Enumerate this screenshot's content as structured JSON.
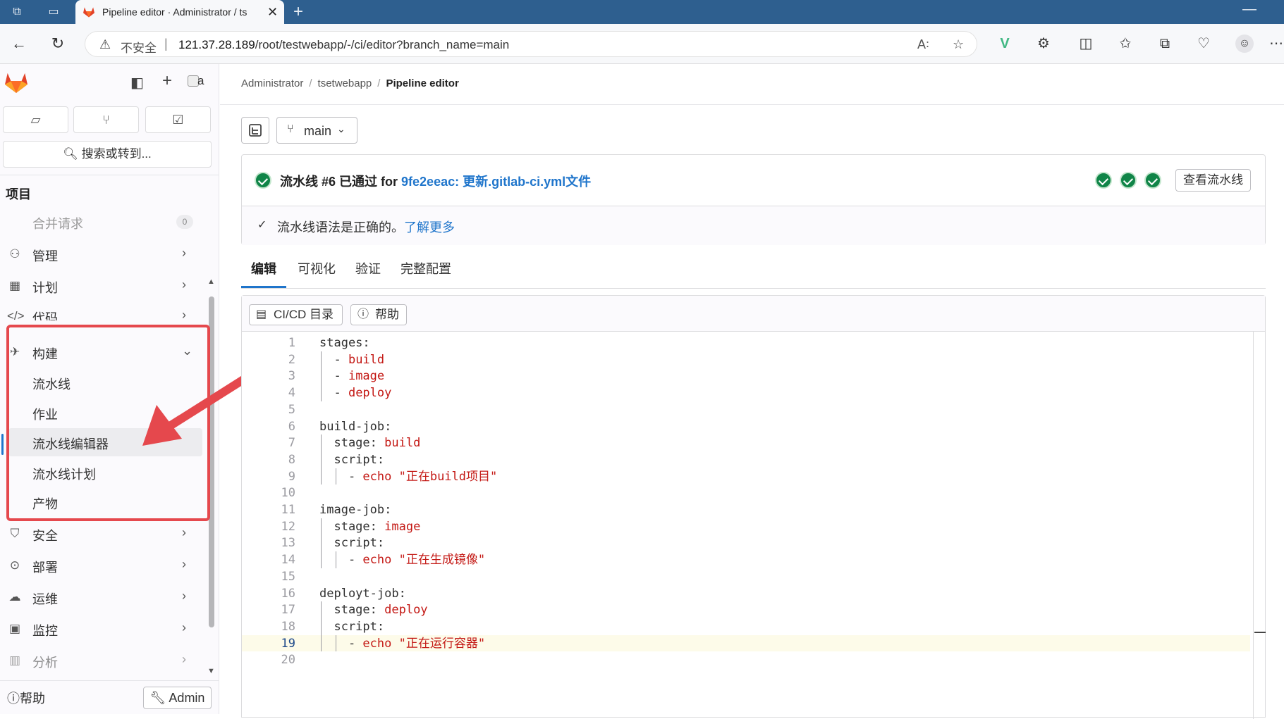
{
  "browser": {
    "tab_title": "Pipeline editor · Administrator / ts",
    "insecure_label": "不安全",
    "url_host": "121.37.28.189",
    "url_path": "/root/testwebapp/-/ci/editor?branch_name=main"
  },
  "sidebar": {
    "search_label": "搜索或转到...",
    "section_title": "项目",
    "merge_requests": {
      "label": "合并请求",
      "count": "0"
    },
    "items": [
      {
        "label": "管理",
        "icon": "users-icon"
      },
      {
        "label": "计划",
        "icon": "calendar-icon"
      },
      {
        "label": "代码",
        "icon": "code-icon"
      },
      {
        "label": "构建",
        "icon": "rocket-icon"
      }
    ],
    "build_sub": [
      {
        "label": "流水线"
      },
      {
        "label": "作业"
      },
      {
        "label": "流水线编辑器",
        "active": true
      },
      {
        "label": "流水线计划"
      },
      {
        "label": "产物"
      }
    ],
    "items_after": [
      {
        "label": "安全",
        "icon": "shield-icon"
      },
      {
        "label": "部署",
        "icon": "deploy-icon"
      },
      {
        "label": "运维",
        "icon": "cloud-icon"
      },
      {
        "label": "监控",
        "icon": "monitor-icon"
      },
      {
        "label": "分析",
        "icon": "chart-icon"
      }
    ],
    "help_label": "帮助",
    "admin_label": "Admin"
  },
  "breadcrumb": {
    "root": "Administrator",
    "project": "tsetwebapp",
    "current": "Pipeline editor"
  },
  "branch": "main",
  "status": {
    "prefix": "流水线 #6 已通过 for ",
    "commit_link": "9fe2eeac: 更新.gitlab-ci.yml文件",
    "view_button": "查看流水线",
    "lint_text": "流水线语法是正确的。",
    "lint_link": "了解更多"
  },
  "tabs": [
    "编辑",
    "可视化",
    "验证",
    "完整配置"
  ],
  "toolbar": {
    "catalog_label": "CI/CD 目录",
    "help_label": "帮助"
  },
  "code_lines": [
    {
      "k": "stages:",
      "v": ""
    },
    {
      "k": "  - ",
      "v": "build"
    },
    {
      "k": "  - ",
      "v": "image"
    },
    {
      "k": "  - ",
      "v": "deploy"
    },
    {
      "k": "",
      "v": ""
    },
    {
      "k": "build-job:",
      "v": ""
    },
    {
      "k": "  stage: ",
      "v": "build"
    },
    {
      "k": "  script:",
      "v": ""
    },
    {
      "k": "    - ",
      "v": "echo \"正在build项目\""
    },
    {
      "k": "",
      "v": ""
    },
    {
      "k": "image-job:",
      "v": ""
    },
    {
      "k": "  stage: ",
      "v": "image"
    },
    {
      "k": "  script:",
      "v": ""
    },
    {
      "k": "    - ",
      "v": "echo \"正在生成镜像\""
    },
    {
      "k": "",
      "v": ""
    },
    {
      "k": "deployt-job:",
      "v": ""
    },
    {
      "k": "  stage: ",
      "v": "deploy"
    },
    {
      "k": "  script:",
      "v": ""
    },
    {
      "k": "    - ",
      "v": "echo \"正在运行容器\""
    },
    {
      "k": "",
      "v": ""
    }
  ],
  "current_line": 19,
  "colors": {
    "accent": "#1f75cb",
    "success": "#108548",
    "annotation": "#e5484d",
    "chrome": "#2e5f8f"
  }
}
